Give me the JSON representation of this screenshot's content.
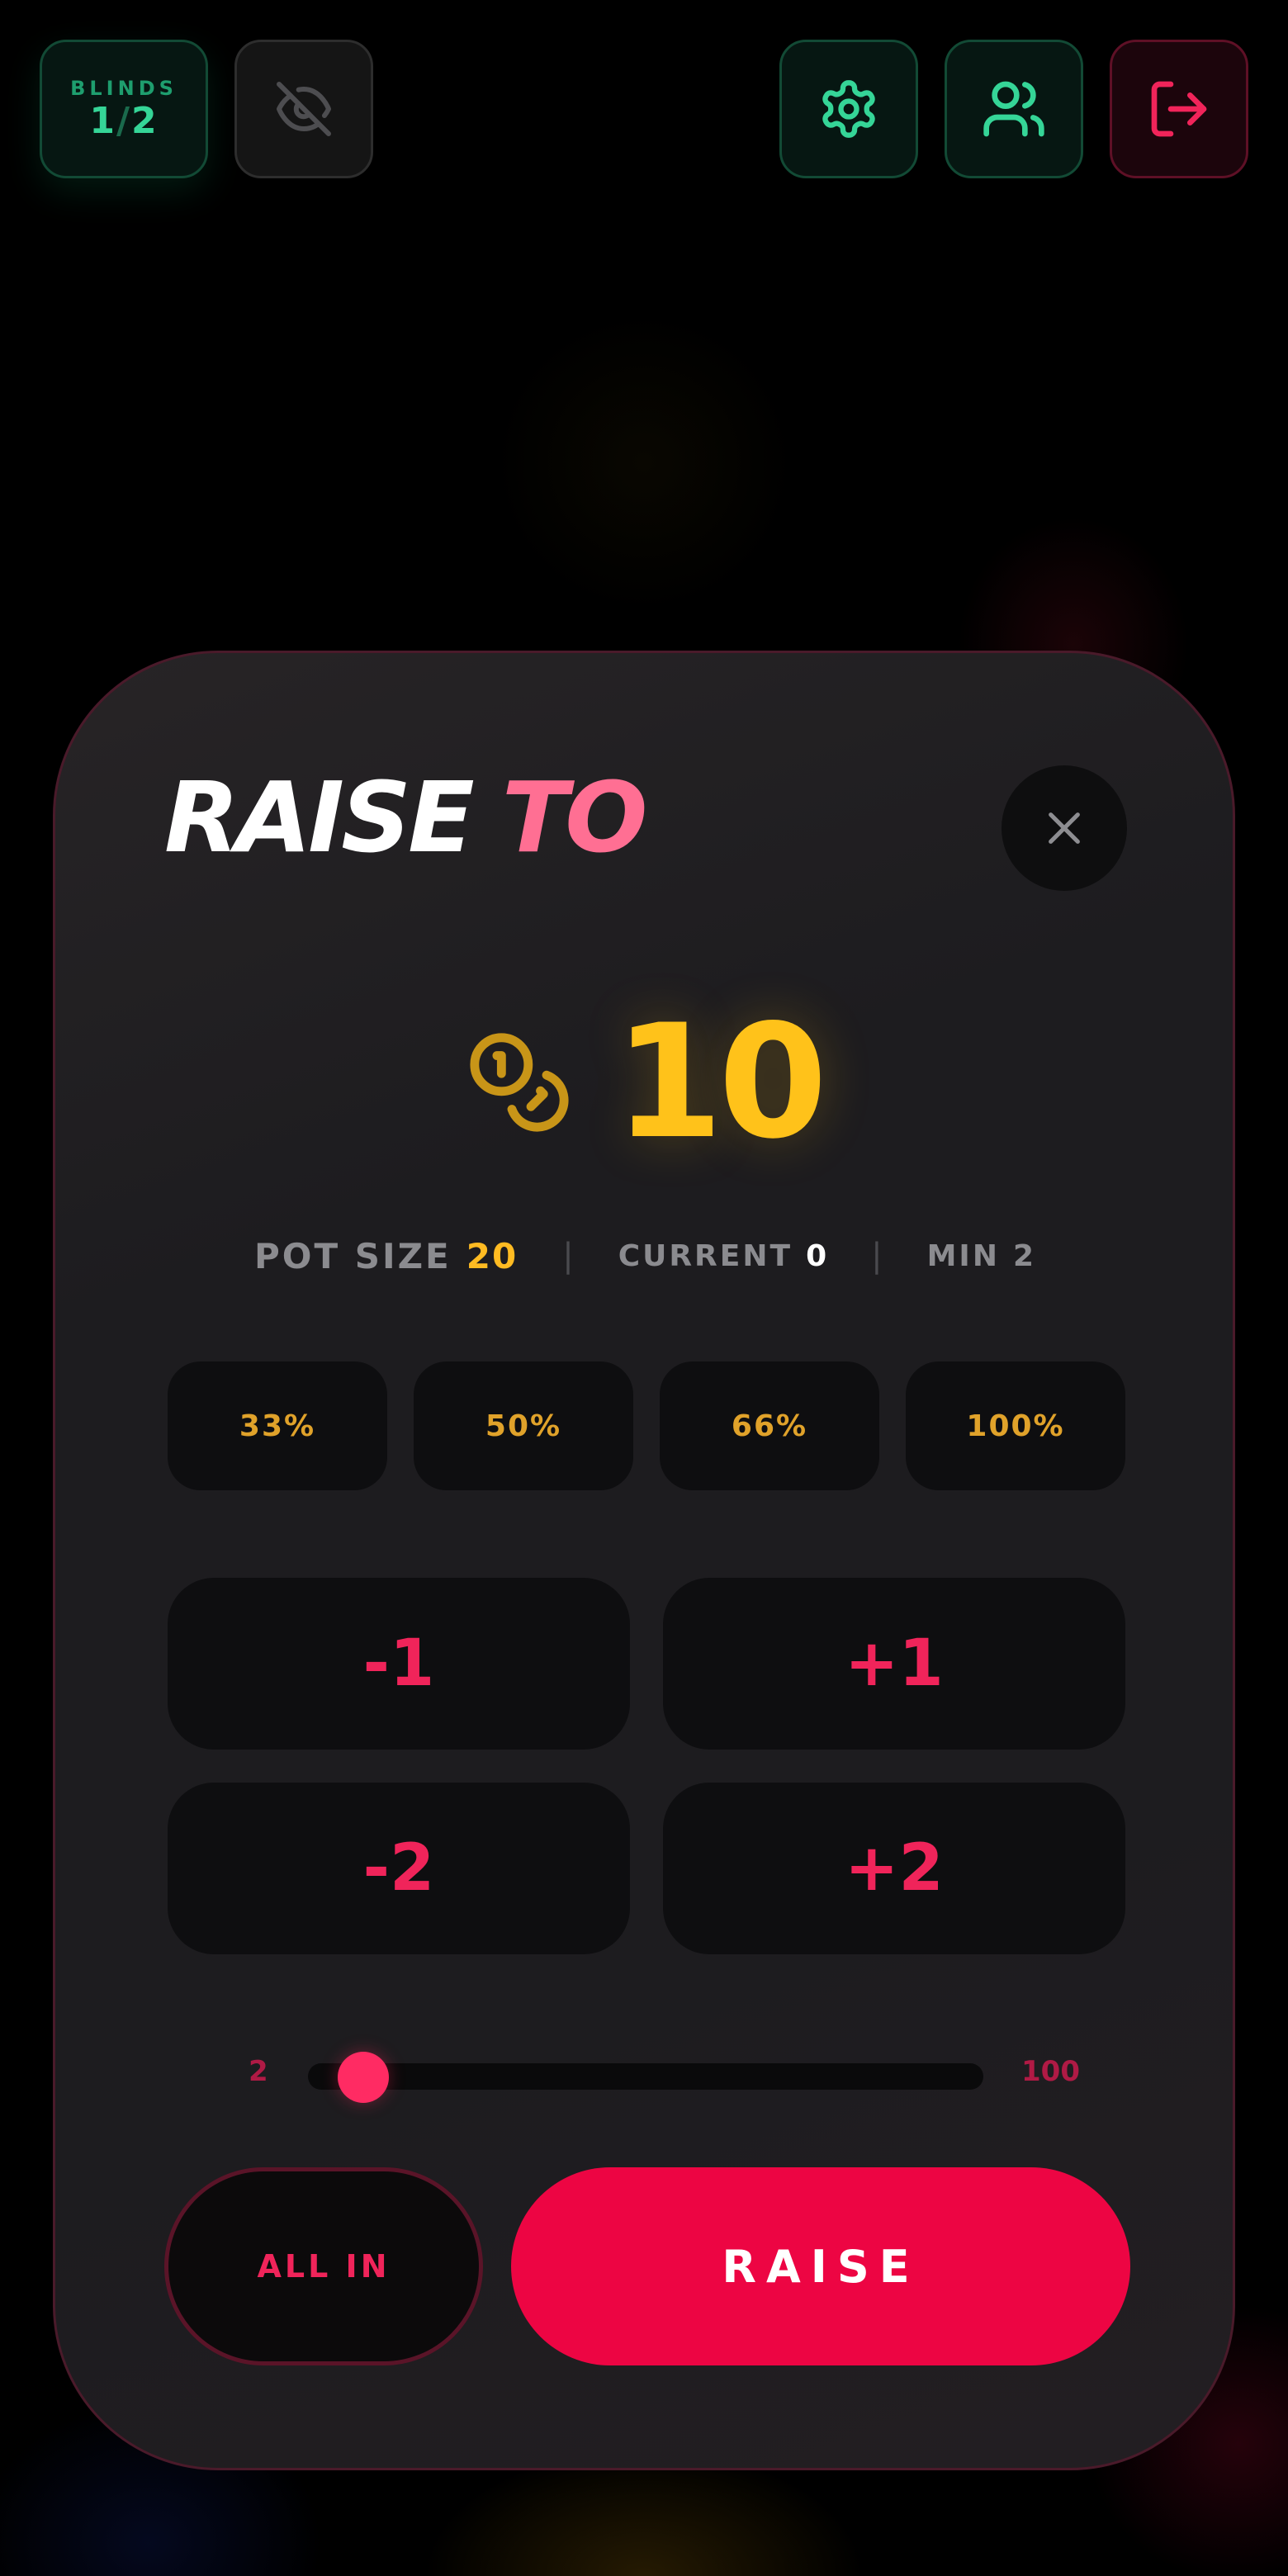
{
  "topbar": {
    "blinds": {
      "label": "BLINDS",
      "small": "1",
      "separator": "/",
      "big": "2"
    },
    "icons": [
      "eye-off-icon",
      "gear-icon",
      "users-icon",
      "logout-icon"
    ]
  },
  "modal": {
    "title_main": "RAISE",
    "title_accent": "TO",
    "amount": "10",
    "info": {
      "pot_label": "POT SIZE",
      "pot_value": "20",
      "current_label": "CURRENT",
      "current_value": "0",
      "min_label": "MIN",
      "min_value": "2"
    },
    "percent_buttons": [
      "33%",
      "50%",
      "66%",
      "100%"
    ],
    "step_buttons": [
      "-1",
      "+1",
      "-2",
      "+2"
    ],
    "slider": {
      "min": "2",
      "max": "100",
      "value": 10
    },
    "allin_label": "ALL IN",
    "raise_label": "RAISE"
  },
  "colors": {
    "accent_red": "#ed0543",
    "gold": "#ffc21a",
    "green": "#35d597",
    "title_accent": "#ff6f93"
  }
}
